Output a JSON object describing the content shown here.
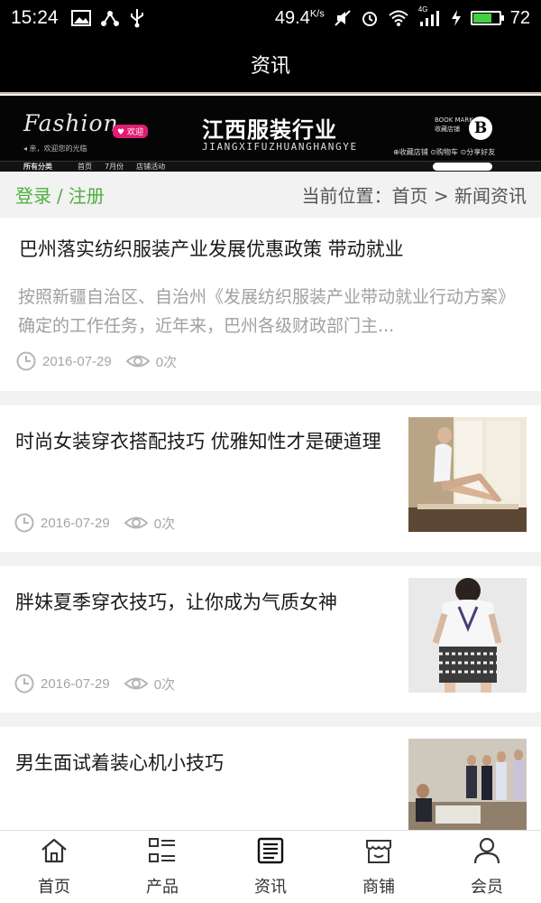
{
  "status_bar": {
    "time": "15:24",
    "speed": "49.4",
    "speed_unit": "K/s",
    "network": "4G",
    "battery": "72",
    "battery_level": 0.72,
    "battery_color": "#3fd13f"
  },
  "header": {
    "title": "资讯"
  },
  "banner": {
    "logo_text": "Fashion",
    "logo_badge": "欢迎",
    "welcome_note": "◂ 亲，欢迎您的光临",
    "site_title": "江西服装行业",
    "site_pinyin": "JIANGXIFUZHUANGHANGYE",
    "bookmark_label": "BOOK MARK",
    "bookmark_sub": "收藏店铺",
    "bookmark_letter": "B",
    "top_links": "⊕收藏店铺  ⊙购物车  ⊙分享好友",
    "nav": [
      "所有分类",
      "首页",
      "7月份",
      "店铺活动"
    ]
  },
  "location_bar": {
    "login": "登录",
    "separator": "/",
    "register": "注册",
    "breadcrumb": "当前位置：首页 > 新闻资讯",
    "accent_color": "#4caf3c"
  },
  "news": [
    {
      "title": "巴州落实纺织服装产业发展优惠政策 带动就业",
      "summary": "按照新疆自治区、自治州《发展纺织服装产业带动就业行动方案》确定的工作任务，近年来，巴州各级财政部门主...",
      "date": "2016-07-29",
      "views": "0次"
    },
    {
      "title": "时尚女装穿衣搭配技巧 优雅知性才是硬道理",
      "date": "2016-07-29",
      "views": "0次",
      "thumb_icon": "photo-woman-on-windowsill"
    },
    {
      "title": "胖妹夏季穿衣技巧，让你成为气质女神",
      "date": "2016-07-29",
      "views": "0次",
      "thumb_icon": "photo-girl-in-shorts"
    },
    {
      "title": "男生面试着装心机小技巧",
      "thumb_icon": "photo-interview-room"
    }
  ],
  "bottom_nav": [
    {
      "label": "首页",
      "icon": "home-icon"
    },
    {
      "label": "产品",
      "icon": "grid-list-icon"
    },
    {
      "label": "资讯",
      "icon": "news-icon",
      "active": true
    },
    {
      "label": "商铺",
      "icon": "store-icon"
    },
    {
      "label": "会员",
      "icon": "user-icon"
    }
  ]
}
